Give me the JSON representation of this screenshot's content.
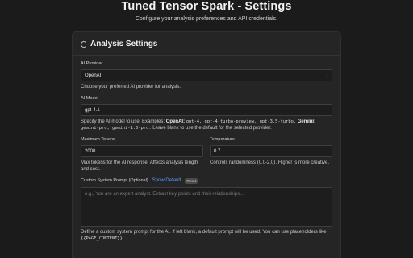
{
  "header": {
    "title": "Tuned Tensor Spark - Settings",
    "subtitle": "Configure your analysis preferences and API credentials."
  },
  "card": {
    "title": "Analysis Settings",
    "icon": "spinner-icon"
  },
  "ai_provider": {
    "label": "AI Provider",
    "value": "OpenAI",
    "help": "Choose your preferred AI provider for analysis."
  },
  "ai_model": {
    "label": "AI Model",
    "value": "gpt-4.1",
    "help_prefix": "Specify the AI model to use. Examples: ",
    "openai_label": "OpenAI:",
    "openai_models": "gpt-4, gpt-4-turbo-preview, gpt-3.5-turbo.",
    "gemini_label": "Gemini:",
    "gemini_models": "gemini-pro, gemini-1.0-pro.",
    "help_suffix": " Leave blank to use the default for the selected provider."
  },
  "max_tokens": {
    "label": "Maximum Tokens",
    "value": "2000",
    "help": "Max tokens for the AI response. Affects analysis length and cost."
  },
  "temperature": {
    "label": "Temperature",
    "value": "0.7",
    "help": "Controls randomness (0.0-2.0). Higher is more creative."
  },
  "system_prompt": {
    "label": "Custom System Prompt (Optional)",
    "show_default": "Show Default",
    "reset": "Reset",
    "placeholder": "e.g., You are an expert analyst. Extract key points and their relationships...",
    "help": "Define a custom system prompt for the AI. If left blank, a default prompt will be used. You can use placeholders like",
    "placeholder_token": "{{PAGE_CONTENT}}."
  }
}
